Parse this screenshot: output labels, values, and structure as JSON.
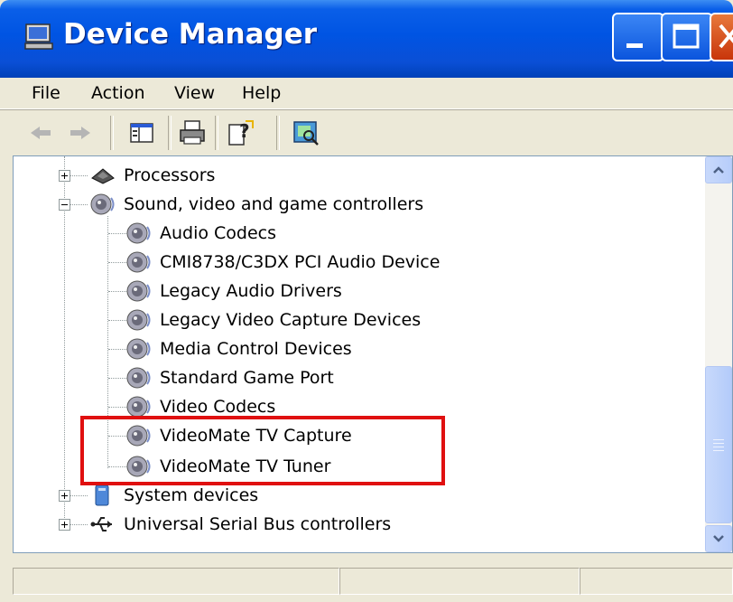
{
  "window": {
    "title": "Device Manager",
    "icon": "computer-icon",
    "controls": [
      "minimize",
      "maximize",
      "close"
    ]
  },
  "menubar": {
    "items": [
      "File",
      "Action",
      "View",
      "Help"
    ]
  },
  "toolbar": {
    "buttons": [
      "back-arrow-icon",
      "forward-arrow-icon",
      "show-hide-console-tree-icon",
      "print-icon",
      "help-icon",
      "scan-hardware-icon"
    ]
  },
  "tree": {
    "rows": [
      {
        "label": "Processors",
        "icon": "processor-icon",
        "level": 0,
        "expander": "plus"
      },
      {
        "label": "Sound, video and game controllers",
        "icon": "speaker-icon",
        "level": 0,
        "expander": "minus"
      },
      {
        "label": "Audio Codecs",
        "icon": "speaker-icon",
        "level": 1
      },
      {
        "label": "CMI8738/C3DX PCI Audio Device",
        "icon": "speaker-icon",
        "level": 1
      },
      {
        "label": "Legacy Audio Drivers",
        "icon": "speaker-icon",
        "level": 1
      },
      {
        "label": "Legacy Video Capture Devices",
        "icon": "speaker-icon",
        "level": 1
      },
      {
        "label": "Media Control Devices",
        "icon": "speaker-icon",
        "level": 1
      },
      {
        "label": "Standard Game Port",
        "icon": "speaker-icon",
        "level": 1
      },
      {
        "label": "Video Codecs",
        "icon": "speaker-icon",
        "level": 1
      },
      {
        "label": "VideoMate TV Capture",
        "icon": "speaker-icon",
        "level": 1
      },
      {
        "label": "VideoMate TV Tuner",
        "icon": "speaker-icon",
        "level": 1
      },
      {
        "label": "System devices",
        "icon": "system-devices-icon",
        "level": 0,
        "expander": "plus"
      },
      {
        "label": "Universal Serial Bus controllers",
        "icon": "usb-icon",
        "level": 0,
        "expander": "plus"
      }
    ]
  },
  "colors": {
    "titlebar": "#0054e3",
    "highlight_box": "#e01010",
    "close_button": "#c8350b"
  }
}
